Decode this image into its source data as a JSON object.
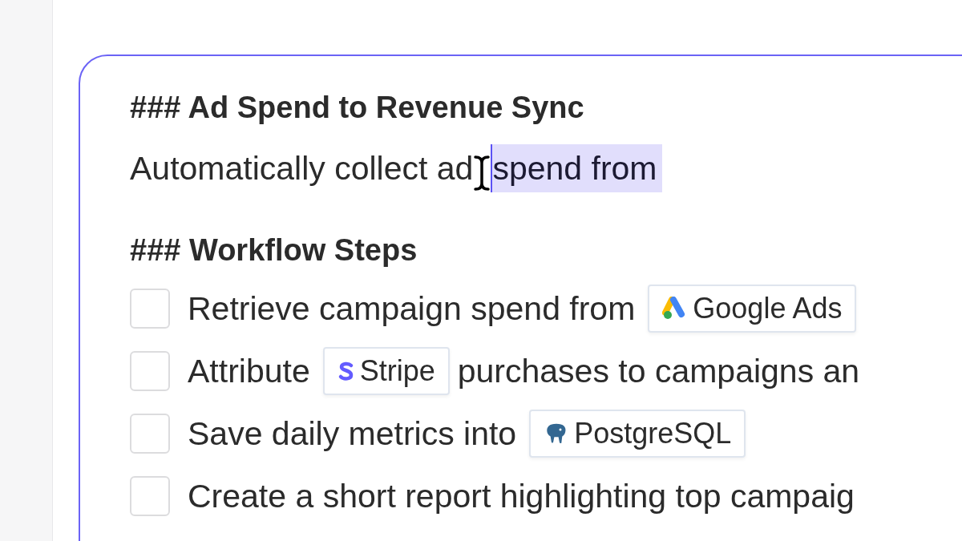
{
  "editor": {
    "heading_1": "### Ad Spend to Revenue Sync",
    "paragraph": [
      {
        "text": "Automatically collect ad",
        "selected": false
      },
      {
        "text": "spend from",
        "selected": true
      }
    ],
    "heading_2": "### Workflow Steps",
    "steps": [
      {
        "checked": false,
        "parts": [
          {
            "kind": "text",
            "text": "Retrieve campaign spend from"
          },
          {
            "kind": "chip",
            "text": "Google Ads"
          }
        ]
      },
      {
        "checked": false,
        "parts": [
          {
            "kind": "text",
            "text": "Attribute"
          },
          {
            "kind": "chip",
            "text": "Stripe"
          },
          {
            "kind": "text",
            "text": "purchases to campaigns an"
          }
        ]
      },
      {
        "checked": false,
        "parts": [
          {
            "kind": "text",
            "text": "Save daily metrics into"
          },
          {
            "kind": "chip",
            "text": "PostgreSQL"
          }
        ]
      },
      {
        "checked": false,
        "parts": [
          {
            "kind": "text",
            "text": "Create a short report highlighting top campaig"
          }
        ]
      }
    ]
  }
}
